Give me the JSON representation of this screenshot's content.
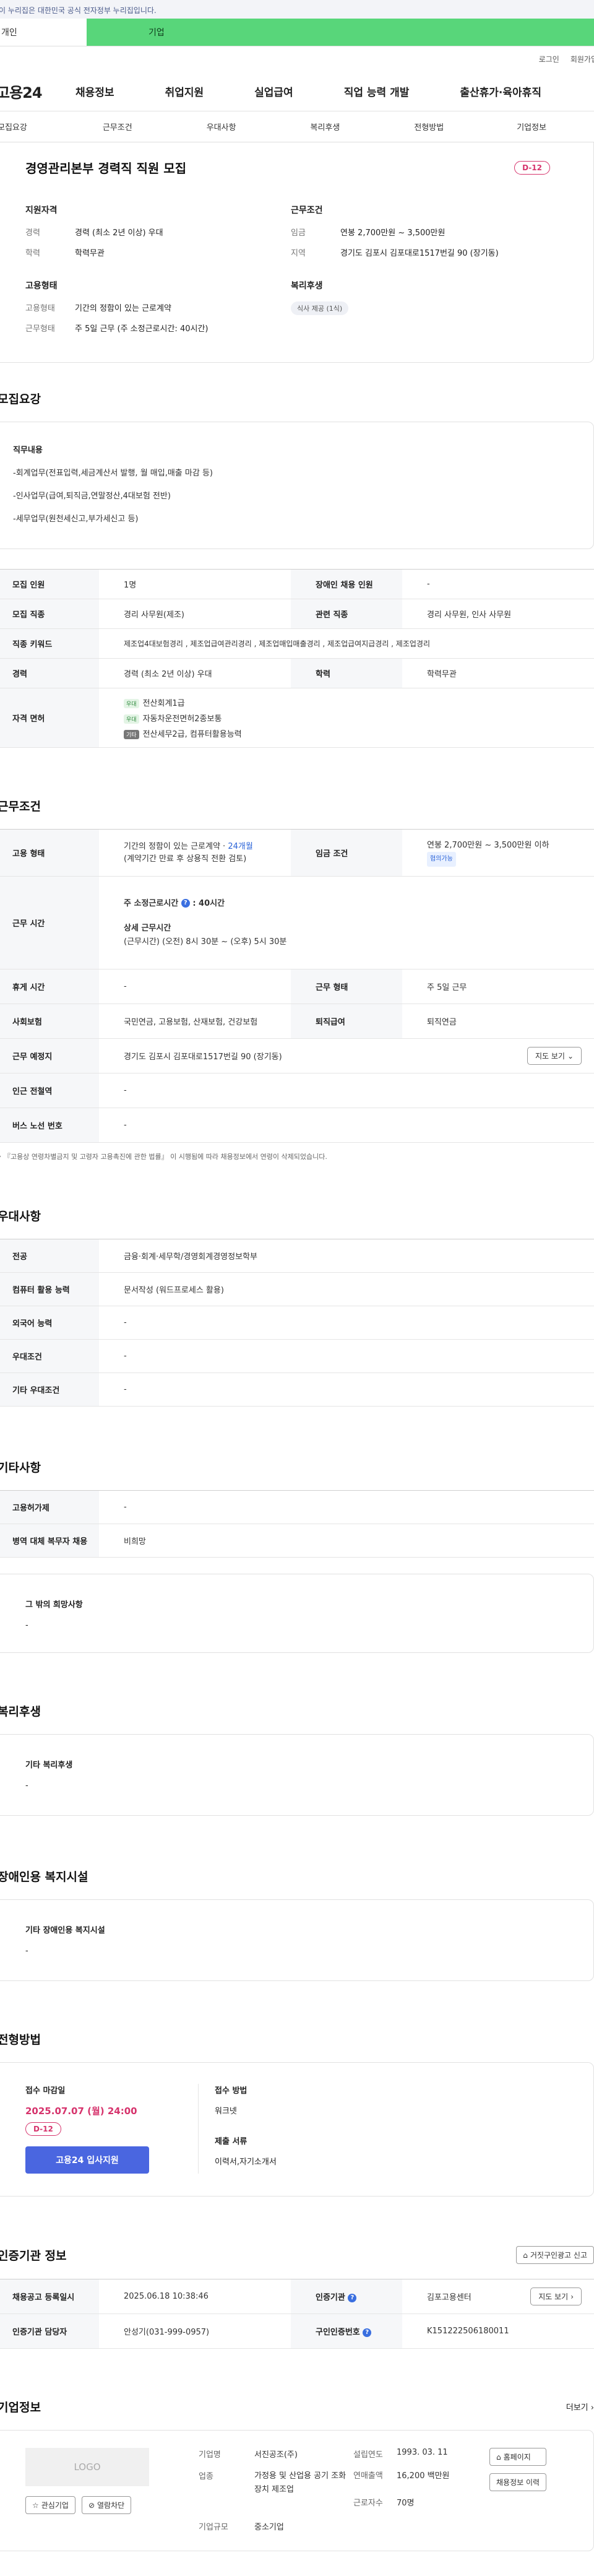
{
  "gov_banner": "이 누리집은 대한민국 공식 전자정부 누리집입니다.",
  "top_tabs": [
    "개인",
    "기업"
  ],
  "util_links": [
    "로그인",
    "회원가입"
  ],
  "gnb": {
    "logo": "고용24",
    "menu": [
      "채용정보",
      "취업지원",
      "실업급여",
      "직업 능력 개발",
      "출산휴가·육아휴직"
    ]
  },
  "section_tabs": [
    "모집요강",
    "근무조건",
    "우대사항",
    "복리후생",
    "전형방법",
    "기업정보"
  ],
  "summary": {
    "title": "경영관리본부 경력직 직원 모집",
    "dday": "D-12",
    "left_heading": "지원자격",
    "career_label": "경력",
    "career": "경력 (최소 2년 이상) 우대",
    "edu_label": "학력",
    "edu": "학력무관",
    "emp_heading": "고용형태",
    "emptype_label": "고용형태",
    "emptype": "기간의 정함이 있는 근로계약",
    "worktype_label": "근무형태",
    "worktype": "주 5일 근무 (주 소정근로시간: 40시간)",
    "right_heading": "근무조건",
    "wage_label": "임금",
    "wage": "연봉 2,700만원 ~ 3,500만원",
    "region_label": "지역",
    "region": "경기도 김포시 김포대로1517번길 90 (장기동)",
    "welfare_heading": "복리후생",
    "welfare_pill": "식사 제공 (1식)"
  },
  "recruit": {
    "heading": "모집요강",
    "duty_title": "직무내용",
    "duties": [
      "-회계업무(전표입력,세금계산서 발행, 월 매입,매출 마감 등)",
      "-인사업무(급여,퇴직금,연말정산,4대보험 전반)",
      "-세무업무(원천세신고,부가세신고 등)"
    ],
    "rows": {
      "headcount_k": "모집 인원",
      "headcount_v": "1명",
      "disabled_k": "장애인 채용 인원",
      "disabled_v": "-",
      "job_k": "모집 직종",
      "job_v": "경리 사무원(제조)",
      "related_k": "관련 직종",
      "related_v": "경리 사무원, 인사 사무원",
      "keyword_k": "직종 키워드",
      "keyword_v": "제조업4대보험경리 , 제조업급여관리경리 , 제조업매입매출경리 , 제조업급여지급경리 , 제조업경리",
      "career_k": "경력",
      "career_v": "경력 (최소 2년 이상) 우대",
      "edu_k": "학력",
      "edu_v": "학력무관",
      "license_k": "자격 면허",
      "licenses": [
        {
          "tag": "우대",
          "name": "전산회계1급"
        },
        {
          "tag": "우대",
          "name": "자동차운전면허2종보통"
        },
        {
          "tag": "기타",
          "name": "전산세무2급, 컴퓨터활용능력"
        }
      ]
    }
  },
  "work": {
    "heading": "근무조건",
    "type_k": "고용 형태",
    "type_v1": "기간의 정함이 있는 근로계약 · ",
    "type_v1b": "24개월",
    "type_v2": "(계약기간 만료 후 상용직 전환 검토)",
    "wage_k": "임금 조건",
    "wage_v": "연봉 2,700만원 ~ 3,500만원 이하",
    "wage_tag": "협의가능",
    "time_k": "근무 시간",
    "time_main": "주 소정근로시간",
    "time_main_v": ": 40시간",
    "time_detail_h": "상세 근무시간",
    "time_detail": "(근무시간) (오전) 8시 30분 ~ (오후) 5시 30분",
    "rest_k": "휴게 시간",
    "rest_v": "-",
    "form_k": "근무 형태",
    "form_v": "주 5일 근무",
    "ins_k": "사회보험",
    "ins_v": "국민연금, 고용보험, 산재보험, 건강보험",
    "retire_k": "퇴직급여",
    "retire_v": "퇴직연금",
    "place_k": "근무 예정지",
    "place_v": "경기도 김포시 김포대로1517번길 90 (장기동)",
    "map_btn": "지도 보기",
    "subway_k": "인근 전철역",
    "subway_v": "-",
    "bus_k": "버스 노선 번호",
    "bus_v": "-",
    "note": "『고용상 연령차별금지 및 고령자 고용촉진에 관한 법률』 이 시행됨에 따라 채용정보에서 연령이 삭제되었습니다."
  },
  "prefer": {
    "heading": "우대사항",
    "major_k": "전공",
    "major_v": "금융·회계·세무학/경영회계경영정보학부",
    "pc_k": "컴퓨터 활용 능력",
    "pc_v": "문서작성 (워드프로세스 활용)",
    "lang_k": "외국어 능력",
    "lang_v": "-",
    "cond_k": "우대조건",
    "cond_v": "-",
    "etc_k": "기타 우대조건",
    "etc_v": "-"
  },
  "other": {
    "heading": "기타사항",
    "ins_k": "고용허가제",
    "ins_v": "-",
    "mil_k": "병역 대체 복무자 채용",
    "mil_v": "비희망",
    "extra_title": "그 밖의 희망사항",
    "extra_v": "-"
  },
  "welfare": {
    "heading": "복리후생",
    "title": "기타 복리후생",
    "value": "-"
  },
  "disabled": {
    "heading": "장애인용 복지시설",
    "title": "기타 장애인용 복지시설",
    "value": "-"
  },
  "apply": {
    "heading": "전형방법",
    "deadline_label": "접수 마감일",
    "deadline": "2025.07.07 (월) 24:00",
    "dday": "D-12",
    "apply_btn": "고용24 입사지원",
    "method_label": "접수 방법",
    "method": "워크넷",
    "docs_label": "제출 서류",
    "docs": "이력서,자기소개서"
  },
  "agency": {
    "heading": "인증기관 정보",
    "report_btn": "거짓구인광고 신고",
    "reg_k": "채용공고 등록일시",
    "reg_v": "2025.06.18 10:38:46",
    "org_k": "인증기관",
    "org_v": "김포고용센터",
    "map_btn": "지도 보기",
    "manager_k": "인증기관 담당자",
    "manager_v": "안성기(031-999-0957)",
    "id_k": "구인인증번호",
    "id_v": "K151222506180011"
  },
  "company": {
    "heading": "기업정보",
    "more": "더보기",
    "logo": "LOGO",
    "fav_btn": "관심기업",
    "block_btn": "열람차단",
    "name_k": "기업명",
    "name_v": "서진공조(주)",
    "est_k": "설립연도",
    "est_v": "1993. 03. 11",
    "ind_k": "업종",
    "ind_v": "가정용 및 산업용 공기 조화장치 제조업",
    "sales_k": "연매출액",
    "sales_v": "16,200 백만원",
    "emp_k": "근로자수",
    "emp_v": "70명",
    "size_k": "기업규모",
    "size_v": "중소기업",
    "home_btn": "홈페이지",
    "jobs_btn": "채용정보 이력"
  }
}
